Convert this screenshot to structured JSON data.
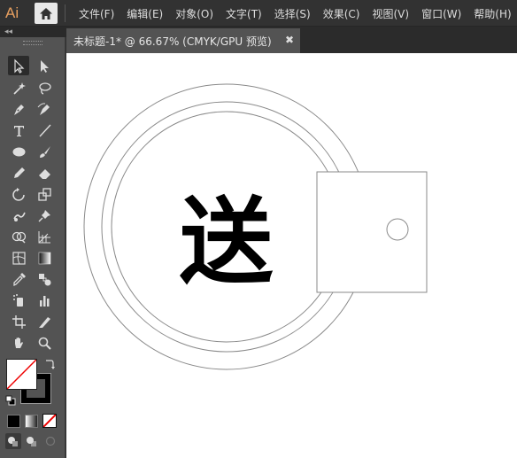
{
  "app": {
    "logo_text": "Ai",
    "accent": "#E8A060"
  },
  "menu": [
    {
      "label": "文件(F)"
    },
    {
      "label": "编辑(E)"
    },
    {
      "label": "对象(O)"
    },
    {
      "label": "文字(T)"
    },
    {
      "label": "选择(S)"
    },
    {
      "label": "效果(C)"
    },
    {
      "label": "视图(V)"
    },
    {
      "label": "窗口(W)"
    },
    {
      "label": "帮助(H)"
    }
  ],
  "panel": {
    "collapse_label": "◂◂"
  },
  "document_tab": {
    "title": "未标题-1* @ 66.67% (CMYK/GPU 预览)",
    "close": "✖"
  },
  "canvas": {
    "glyph": "送"
  },
  "tools": [
    "selection-tool",
    "direct-selection-tool",
    "magic-wand-tool",
    "lasso-tool",
    "pen-tool",
    "curvature-tool",
    "type-tool",
    "line-segment-tool",
    "ellipse-tool",
    "paintbrush-tool",
    "pencil-tool",
    "eraser-tool",
    "rotate-tool",
    "scale-tool",
    "warp-tool",
    "puppet-warp-tool",
    "shape-builder-tool",
    "perspective-grid-tool",
    "mesh-tool",
    "gradient-tool",
    "eyedropper-tool",
    "blend-tool",
    "symbol-sprayer-tool",
    "column-graph-tool",
    "artboard-tool",
    "slice-tool",
    "hand-tool",
    "zoom-tool"
  ]
}
